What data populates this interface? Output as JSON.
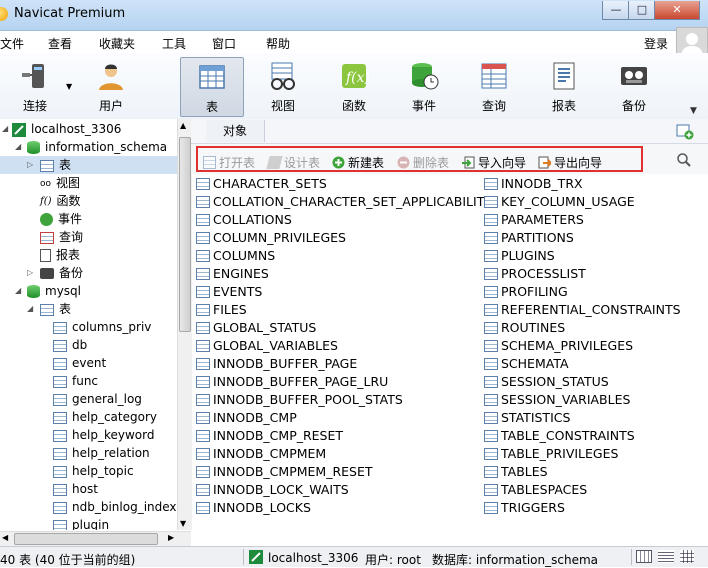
{
  "window": {
    "title": "Navicat Premium",
    "min": "—",
    "max": "□",
    "close": "✕"
  },
  "menu": [
    "文件",
    "查看",
    "收藏夹",
    "工具",
    "窗口",
    "帮助"
  ],
  "login": "登录",
  "toolbar": [
    {
      "label": "连接",
      "icon": "connection-icon"
    },
    {
      "label": "用户",
      "icon": "user-icon"
    },
    {
      "label": "表",
      "icon": "table-icon"
    },
    {
      "label": "视图",
      "icon": "view-icon"
    },
    {
      "label": "函数",
      "icon": "function-icon"
    },
    {
      "label": "事件",
      "icon": "event-icon"
    },
    {
      "label": "查询",
      "icon": "query-icon"
    },
    {
      "label": "报表",
      "icon": "report-icon"
    },
    {
      "label": "备份",
      "icon": "backup-icon"
    }
  ],
  "tree": {
    "connection": "localhost_3306",
    "db1": "information_schema",
    "db1_children": [
      "表",
      "视图",
      "函数",
      "事件",
      "查询",
      "报表",
      "备份"
    ],
    "db2": "mysql",
    "db2_table_group": "表",
    "db2_tables": [
      "columns_priv",
      "db",
      "event",
      "func",
      "general_log",
      "help_category",
      "help_keyword",
      "help_relation",
      "help_topic",
      "host",
      "ndb_binlog_index",
      "plugin"
    ]
  },
  "objects_tab": "对象",
  "actions": {
    "open": "打开表",
    "design": "设计表",
    "new": "新建表",
    "delete": "删除表",
    "import": "导入向导",
    "export": "导出向导"
  },
  "tables_col1": [
    "CHARACTER_SETS",
    "COLLATION_CHARACTER_SET_APPLICABILITY",
    "COLLATIONS",
    "COLUMN_PRIVILEGES",
    "COLUMNS",
    "ENGINES",
    "EVENTS",
    "FILES",
    "GLOBAL_STATUS",
    "GLOBAL_VARIABLES",
    "INNODB_BUFFER_PAGE",
    "INNODB_BUFFER_PAGE_LRU",
    "INNODB_BUFFER_POOL_STATS",
    "INNODB_CMP",
    "INNODB_CMP_RESET",
    "INNODB_CMPMEM",
    "INNODB_CMPMEM_RESET",
    "INNODB_LOCK_WAITS",
    "INNODB_LOCKS"
  ],
  "tables_col2": [
    "INNODB_TRX",
    "KEY_COLUMN_USAGE",
    "PARAMETERS",
    "PARTITIONS",
    "PLUGINS",
    "PROCESSLIST",
    "PROFILING",
    "REFERENTIAL_CONSTRAINTS",
    "ROUTINES",
    "SCHEMA_PRIVILEGES",
    "SCHEMATA",
    "SESSION_STATUS",
    "SESSION_VARIABLES",
    "STATISTICS",
    "TABLE_CONSTRAINTS",
    "TABLE_PRIVILEGES",
    "TABLES",
    "TABLESPACES",
    "TRIGGERS"
  ],
  "status": {
    "count": "40 表 (40 位于当前的组)",
    "connection": "localhost_3306",
    "user": "用户: root",
    "database": "数据库: information_schema"
  },
  "colors": {
    "highlight": "#e03030",
    "titlebar": "#b5d3f1"
  }
}
